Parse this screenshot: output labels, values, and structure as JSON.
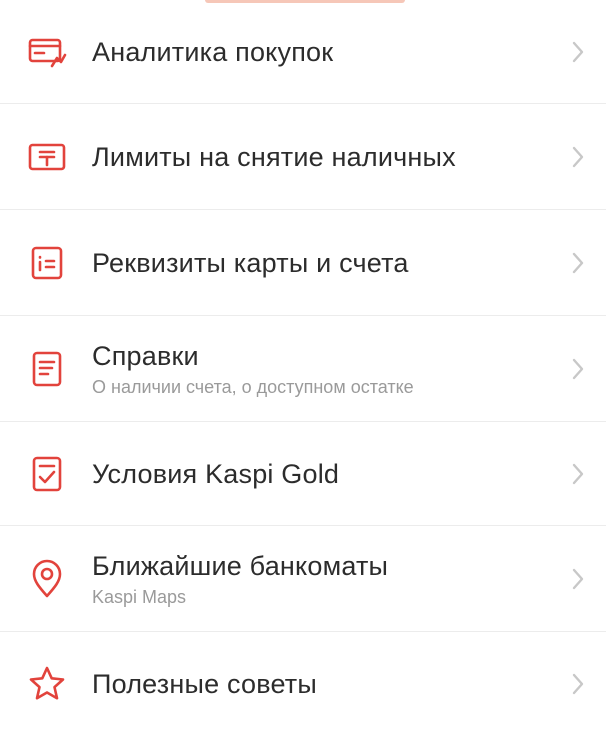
{
  "colors": {
    "accent": "#e2433c",
    "title": "#2c2c2c",
    "subtitle": "#9a9a9a",
    "chevron": "#c8c8c8",
    "divider": "#ececec"
  },
  "menu": {
    "items": [
      {
        "icon": "card-analytics-icon",
        "title": "Аналитика покупок",
        "subtitle": ""
      },
      {
        "icon": "cash-withdrawal-icon",
        "title": "Лимиты на снятие наличных",
        "subtitle": ""
      },
      {
        "icon": "card-details-icon",
        "title": "Реквизиты карты и счета",
        "subtitle": ""
      },
      {
        "icon": "document-icon",
        "title": "Справки",
        "subtitle": "О наличии счета, о доступном остатке"
      },
      {
        "icon": "terms-check-icon",
        "title": "Условия Kaspi Gold",
        "subtitle": ""
      },
      {
        "icon": "map-pin-icon",
        "title": "Ближайшие банкоматы",
        "subtitle": "Kaspi Maps"
      },
      {
        "icon": "star-icon",
        "title": "Полезные советы",
        "subtitle": ""
      }
    ]
  }
}
